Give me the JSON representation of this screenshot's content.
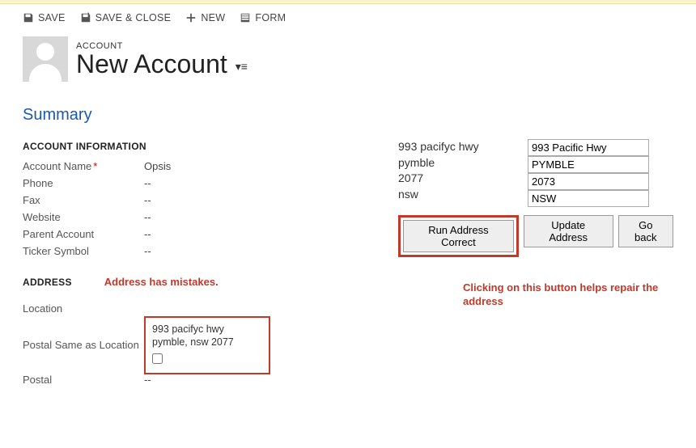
{
  "toolbar": {
    "save": "SAVE",
    "save_close": "SAVE & CLOSE",
    "new": "NEW",
    "form": "FORM"
  },
  "header": {
    "entity_label": "ACCOUNT",
    "title": "New Account"
  },
  "summary_heading": "Summary",
  "sections": {
    "account_info_heading": "ACCOUNT INFORMATION",
    "address_heading": "ADDRESS"
  },
  "account_info": {
    "labels": {
      "account_name": "Account Name",
      "phone": "Phone",
      "fax": "Fax",
      "website": "Website",
      "parent_account": "Parent Account",
      "ticker_symbol": "Ticker Symbol"
    },
    "values": {
      "account_name": "Opsis",
      "phone": "--",
      "fax": "--",
      "website": "--",
      "parent_account": "--",
      "ticker_symbol": "--"
    }
  },
  "address": {
    "labels": {
      "location": "Location",
      "postal_same": "Postal Same as Location",
      "postal": "Postal"
    },
    "values": {
      "location_line1": "993 pacifyc hwy",
      "location_line2": "pymble, nsw 2077",
      "postal": "--"
    }
  },
  "annotations": {
    "mistakes": "Address has mistakes.",
    "repair": "Clicking on this button helps repair the address"
  },
  "right_panel": {
    "original": {
      "line1": "993 pacifyc hwy",
      "line2": "pymble",
      "line3": "2077",
      "line4": "nsw"
    },
    "corrected": {
      "street": "993 Pacific Hwy",
      "city": "PYMBLE",
      "postcode": "2073",
      "state": "NSW"
    },
    "buttons": {
      "run": "Run Address Correct",
      "update": "Update Address",
      "back": "Go back"
    }
  }
}
